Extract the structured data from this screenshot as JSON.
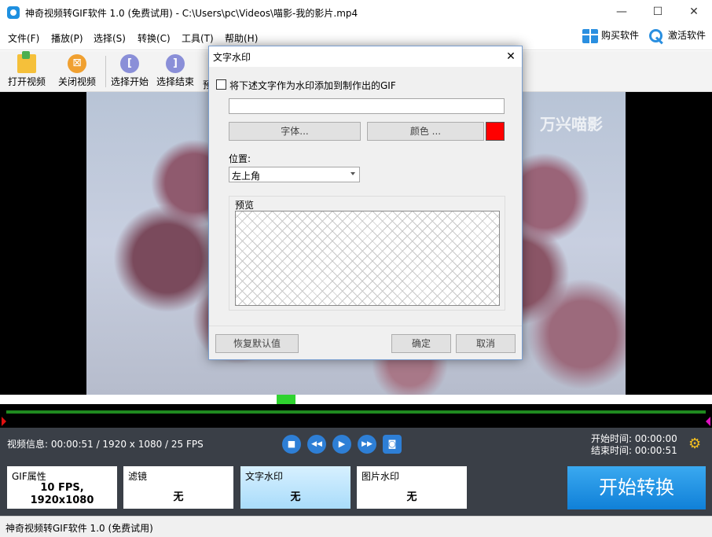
{
  "window": {
    "title": "神奇视频转GIF软件 1.0 (免费试用) - C:\\Users\\pc\\Videos\\喵影-我的影片.mp4",
    "minimize": "—",
    "maximize": "☐",
    "close": "✕"
  },
  "menu": {
    "items": [
      "文件(F)",
      "播放(P)",
      "选择(S)",
      "转换(C)",
      "工具(T)",
      "帮助(H)"
    ],
    "buy": "购买软件",
    "activate": "激活软件"
  },
  "toolbar": {
    "open": "打开视频",
    "close_video": "关闭视频",
    "select_start": "选择开始",
    "select_end": "选择结束",
    "preview_partial": "预",
    "start_icon": "[",
    "end_icon": "]"
  },
  "video": {
    "watermark": "万兴喵影"
  },
  "info": {
    "label": "视频信息: 00:00:51 / 1920 x 1080 / 25 FPS",
    "start_time": "开始时间: 00:00:00",
    "end_time": "结束时间: 00:00:51",
    "icons": {
      "stop": "■",
      "rewind": "◀◀",
      "play": "▶",
      "forward": "▶▶",
      "snapshot": "◙",
      "settings": "⚙"
    }
  },
  "cards": [
    {
      "title": "GIF属性",
      "value_line1": "10 FPS,",
      "value_line2": "1920x1080"
    },
    {
      "title": "滤镜",
      "value": "无"
    },
    {
      "title": "文字水印",
      "value": "无"
    },
    {
      "title": "图片水印",
      "value": "无"
    }
  ],
  "start_button": "开始转换",
  "status": "神奇视频转GIF软件 1.0 (免费试用)",
  "dialog": {
    "title": "文字水印",
    "close": "✕",
    "checkbox_label": "将下述文字作为水印添加到制作出的GIF",
    "text_value": "",
    "font_button": "字体...",
    "color_button": "颜色 ...",
    "color": "#ff0000",
    "position_label": "位置:",
    "position_value": "左上角",
    "preview_label": "预览",
    "reset_button": "恢复默认值",
    "ok_button": "确定",
    "cancel_button": "取消"
  }
}
